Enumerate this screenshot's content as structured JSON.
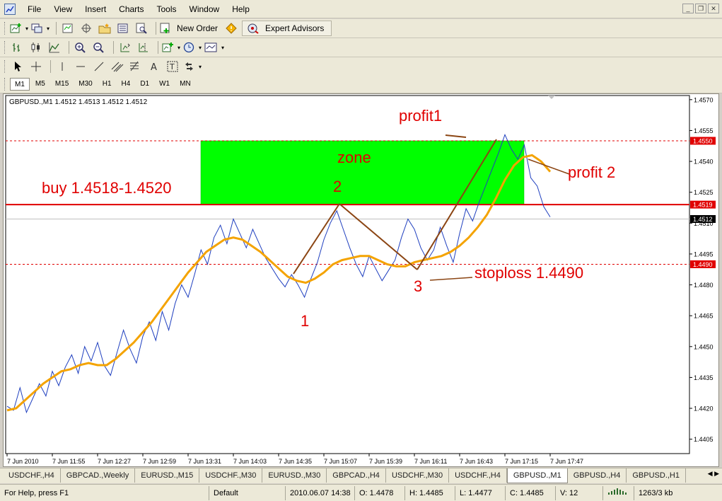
{
  "menu": [
    "File",
    "View",
    "Insert",
    "Charts",
    "Tools",
    "Window",
    "Help"
  ],
  "toolbar1": {
    "new_order": "New Order",
    "expert_advisors": "Expert Advisors"
  },
  "timeframes": [
    "M1",
    "M5",
    "M15",
    "M30",
    "H1",
    "H4",
    "D1",
    "W1",
    "MN"
  ],
  "active_timeframe": "M1",
  "chart": {
    "header": "GBPUSD.,M1  1.4512 1.4513 1.4512 1.4512",
    "price_ticks": [
      "1.4570",
      "1.4555",
      "1.4540",
      "1.4525",
      "1.4510",
      "1.4495",
      "1.4480",
      "1.4465",
      "1.4450",
      "1.4435",
      "1.4420",
      "1.4405"
    ],
    "price_labels": {
      "upper": "1.4550",
      "buy": "1.4519",
      "current": "1.4512",
      "stop": "1.4490"
    },
    "time_ticks": [
      "7 Jun 2010",
      "7 Jun 11:55",
      "7 Jun 12:27",
      "7 Jun 12:59",
      "7 Jun 13:31",
      "7 Jun 14:03",
      "7 Jun 14:35",
      "7 Jun 15:07",
      "7 Jun 15:39",
      "7 Jun 16:11",
      "7 Jun 16:43",
      "7 Jun 17:15",
      "7 Jun 17:47"
    ],
    "annotations": {
      "zone": "zone",
      "buy": "buy 1.4518-1.4520",
      "profit1": "profit1",
      "profit2": "profit 2",
      "stoploss": "stoploss 1.4490",
      "point1": "1",
      "point2": "2",
      "point3": "3"
    },
    "colors": {
      "price_line": "#1f3fbf",
      "moving_average": "#f4a300",
      "zone": "#00ff00",
      "level": "#ff0000",
      "annotation_text": "#e00000",
      "arrow": "#8b4513"
    }
  },
  "chart_data": {
    "type": "line",
    "symbol": "GBPUSD.",
    "timeframe": "M1",
    "ylim": [
      1.4398,
      1.4572
    ],
    "x_ticks": [
      "7 Jun 2010",
      "7 Jun 11:55",
      "7 Jun 12:27",
      "7 Jun 12:59",
      "7 Jun 13:31",
      "7 Jun 14:03",
      "7 Jun 14:35",
      "7 Jun 15:07",
      "7 Jun 15:39",
      "7 Jun 16:11",
      "7 Jun 16:43",
      "7 Jun 17:15",
      "7 Jun 17:47"
    ],
    "y_ticks": [
      1.457,
      1.4555,
      1.454,
      1.4525,
      1.451,
      1.4495,
      1.448,
      1.4465,
      1.445,
      1.4435,
      1.442,
      1.4405
    ],
    "series": [
      {
        "kind": "price",
        "values": [
          1.4421,
          1.4419,
          1.443,
          1.4418,
          1.4425,
          1.4432,
          1.4426,
          1.4438,
          1.4431,
          1.444,
          1.4446,
          1.4437,
          1.445,
          1.4443,
          1.4452,
          1.4441,
          1.4436,
          1.4447,
          1.4458,
          1.4449,
          1.4442,
          1.4455,
          1.4462,
          1.4453,
          1.4467,
          1.4458,
          1.4471,
          1.448,
          1.4474,
          1.4485,
          1.4497,
          1.449,
          1.4503,
          1.4509,
          1.45,
          1.4512,
          1.4505,
          1.4498,
          1.4507,
          1.45,
          1.4493,
          1.4488,
          1.4483,
          1.4479,
          1.4485,
          1.448,
          1.4474,
          1.4483,
          1.4491,
          1.4502,
          1.451,
          1.4516,
          1.4507,
          1.4498,
          1.449,
          1.4484,
          1.4494,
          1.4488,
          1.4482,
          1.4487,
          1.4492,
          1.4503,
          1.4512,
          1.4507,
          1.4498,
          1.4492,
          1.4497,
          1.4508,
          1.4499,
          1.4491,
          1.4505,
          1.4517,
          1.4511,
          1.452,
          1.4528,
          1.4536,
          1.4544,
          1.4553,
          1.4546,
          1.4541,
          1.4548,
          1.4532,
          1.4528,
          1.4518,
          1.4513
        ]
      },
      {
        "kind": "moving_average",
        "values": [
          1.4419,
          1.442,
          1.4424,
          1.4428,
          1.4432,
          1.4435,
          1.4438,
          1.4439,
          1.4441,
          1.4442,
          1.4441,
          1.4441,
          1.4444,
          1.4448,
          1.4452,
          1.4457,
          1.4462,
          1.4468,
          1.4474,
          1.448,
          1.4486,
          1.4491,
          1.4496,
          1.4499,
          1.4502,
          1.4503,
          1.4502,
          1.4499,
          1.4496,
          1.4492,
          1.4488,
          1.4484,
          1.4482,
          1.4481,
          1.4483,
          1.4486,
          1.449,
          1.4492,
          1.4493,
          1.4494,
          1.4494,
          1.4492,
          1.449,
          1.4489,
          1.4489,
          1.4491,
          1.4492,
          1.4493,
          1.4494,
          1.4496,
          1.4499,
          1.4503,
          1.4508,
          1.4514,
          1.4522,
          1.4531,
          1.4538,
          1.4542,
          1.4543,
          1.454,
          1.4535
        ]
      }
    ],
    "levels": [
      {
        "price": 1.455,
        "style": "dashed"
      },
      {
        "price": 1.4519,
        "style": "solid"
      },
      {
        "price": 1.449,
        "style": "dashed"
      }
    ],
    "zone": {
      "from": 1.4519,
      "to": 1.455
    }
  },
  "tabs": [
    "USDCHF.,H4",
    "GBPCAD.,Weekly",
    "EURUSD.,M15",
    "USDCHF.,M30",
    "EURUSD.,M30",
    "GBPCAD.,H4",
    "USDCHF.,M30",
    "USDCHF.,H4",
    "GBPUSD.,M1",
    "GBPUSD.,H4",
    "GBPUSD.,H1"
  ],
  "active_tab": "GBPUSD.,M1",
  "status": {
    "help": "For Help, press F1",
    "profile": "Default",
    "datetime": "2010.06.07 14:38",
    "open": "O: 1.4478",
    "high": "H: 1.4485",
    "low": "L: 1.4477",
    "close": "C: 1.4485",
    "volume": "V: 12",
    "traffic": "1263/3 kb"
  }
}
